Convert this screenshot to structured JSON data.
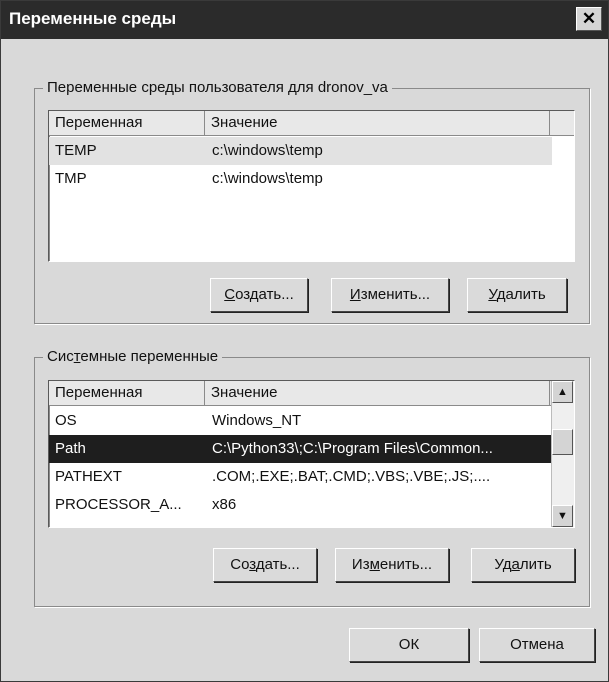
{
  "window": {
    "title": "Переменные среды",
    "close_label": "✕"
  },
  "user_group": {
    "legend": "Переменные среды пользователя для dronov_va",
    "columns": [
      "Переменная",
      "Значение"
    ],
    "rows": [
      {
        "name": "TEMP",
        "value": "c:\\windows\\temp"
      },
      {
        "name": "TMP",
        "value": "c:\\windows\\temp"
      }
    ],
    "buttons": {
      "create": {
        "pre": "",
        "ul": "С",
        "post": "оздать..."
      },
      "edit": {
        "pre": "",
        "ul": "И",
        "post": "зменить..."
      },
      "delete": {
        "pre": "",
        "ul": "У",
        "post": "далить"
      }
    }
  },
  "system_group": {
    "legend_pre": "Сис",
    "legend_ul": "т",
    "legend_post": "емные переменные",
    "columns": [
      "Переменная",
      "Значение"
    ],
    "rows": [
      {
        "name": "OS",
        "value": "Windows_NT"
      },
      {
        "name": "Path",
        "value": "C:\\Python33\\;C:\\Program Files\\Common..."
      },
      {
        "name": "PATHEXT",
        "value": ".COM;.EXE;.BAT;.CMD;.VBS;.VBE;.JS;...."
      },
      {
        "name": "PROCESSOR_A...",
        "value": "x86"
      }
    ],
    "buttons": {
      "create": {
        "pre": "Со",
        "ul": "з",
        "post": "дать..."
      },
      "edit": {
        "pre": "Из",
        "ul": "м",
        "post": "енить..."
      },
      "delete": {
        "pre": "Уд",
        "ul": "а",
        "post": "лить"
      }
    }
  },
  "footer": {
    "ok_label": "ОК",
    "cancel_label": "Отмена"
  },
  "icons": {
    "scroll_up": "▲",
    "scroll_down": "▼"
  }
}
